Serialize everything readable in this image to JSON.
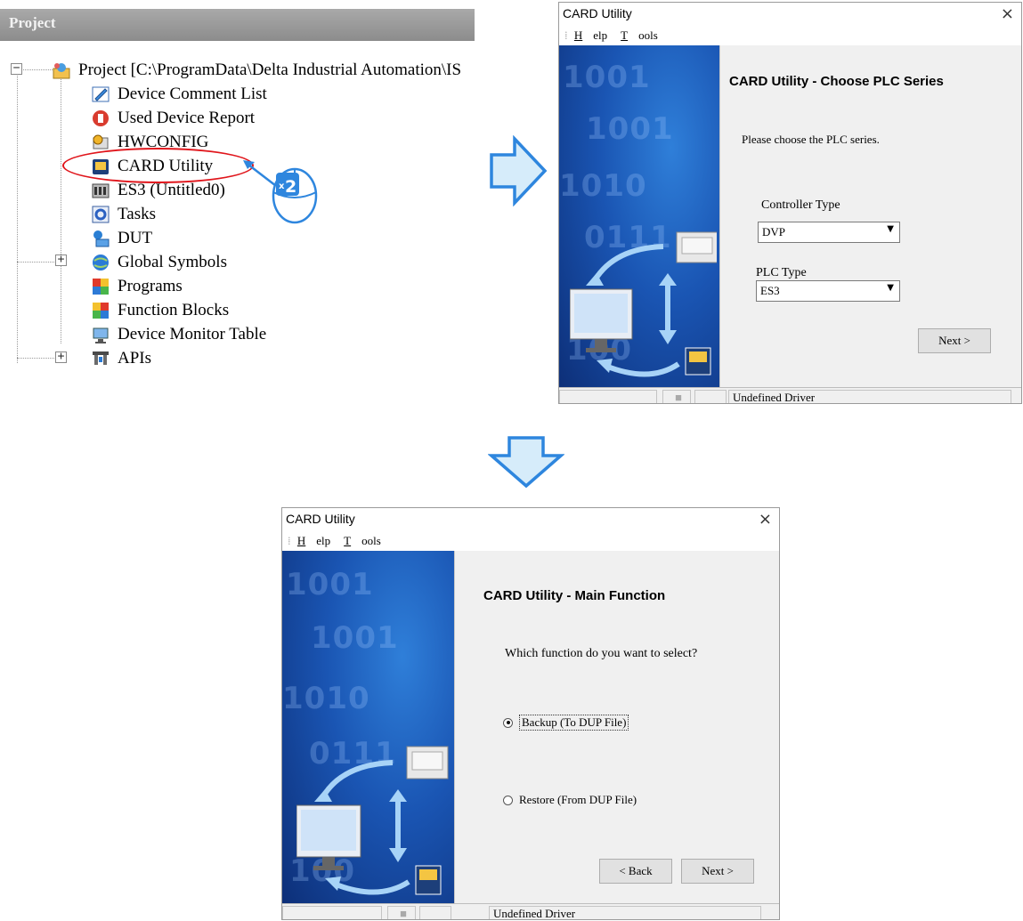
{
  "project_panel": {
    "title": "Project",
    "items": [
      {
        "label": "Project [C:\\ProgramData\\Delta Industrial Automation\\IS",
        "icon": "project-icon"
      },
      {
        "label": "Device Comment List",
        "icon": "comment-list-icon"
      },
      {
        "label": "Used Device Report",
        "icon": "device-report-icon"
      },
      {
        "label": "HWCONFIG",
        "icon": "hwconfig-icon"
      },
      {
        "label": "CARD Utility",
        "icon": "card-utility-icon"
      },
      {
        "label": "ES3  (Untitled0)",
        "icon": "es3-icon"
      },
      {
        "label": "Tasks",
        "icon": "tasks-icon"
      },
      {
        "label": "DUT",
        "icon": "dut-icon"
      },
      {
        "label": "Global Symbols",
        "icon": "global-symbols-icon"
      },
      {
        "label": "Programs",
        "icon": "programs-icon"
      },
      {
        "label": "Function Blocks",
        "icon": "function-blocks-icon"
      },
      {
        "label": "Device Monitor Table",
        "icon": "device-monitor-icon"
      },
      {
        "label": "APIs",
        "icon": "apis-icon"
      }
    ]
  },
  "callout": {
    "mouse_label": "x2",
    "click_count": "2"
  },
  "dialog1": {
    "title": "CARD Utility",
    "menu": {
      "help": "Help",
      "tools": "Tools"
    },
    "heading": "CARD Utility - Choose PLC Series",
    "prompt": "Please choose the PLC series.",
    "controller_type_label": "Controller Type",
    "controller_type_value": "DVP",
    "plc_type_label": "PLC Type",
    "plc_type_value": "ES3",
    "next_label": "Next >",
    "status_driver": "Undefined Driver"
  },
  "dialog2": {
    "title": "CARD Utility",
    "menu": {
      "help": "Help",
      "tools": "Tools"
    },
    "heading": "CARD Utility - Main Function",
    "prompt": "Which function do you want to select?",
    "option_backup": "Backup (To DUP File)",
    "option_restore": "Restore (From DUP File)",
    "selected_option": "Backup (To DUP File)",
    "back_label": "< Back",
    "next_label": "Next >",
    "status_driver": "Undefined Driver"
  },
  "colors": {
    "arrow_fill": "#d6ecfa",
    "arrow_stroke": "#2e86de",
    "highlight_ellipse": "#e0151b",
    "dialog_art_blue": "#1a55b3"
  }
}
